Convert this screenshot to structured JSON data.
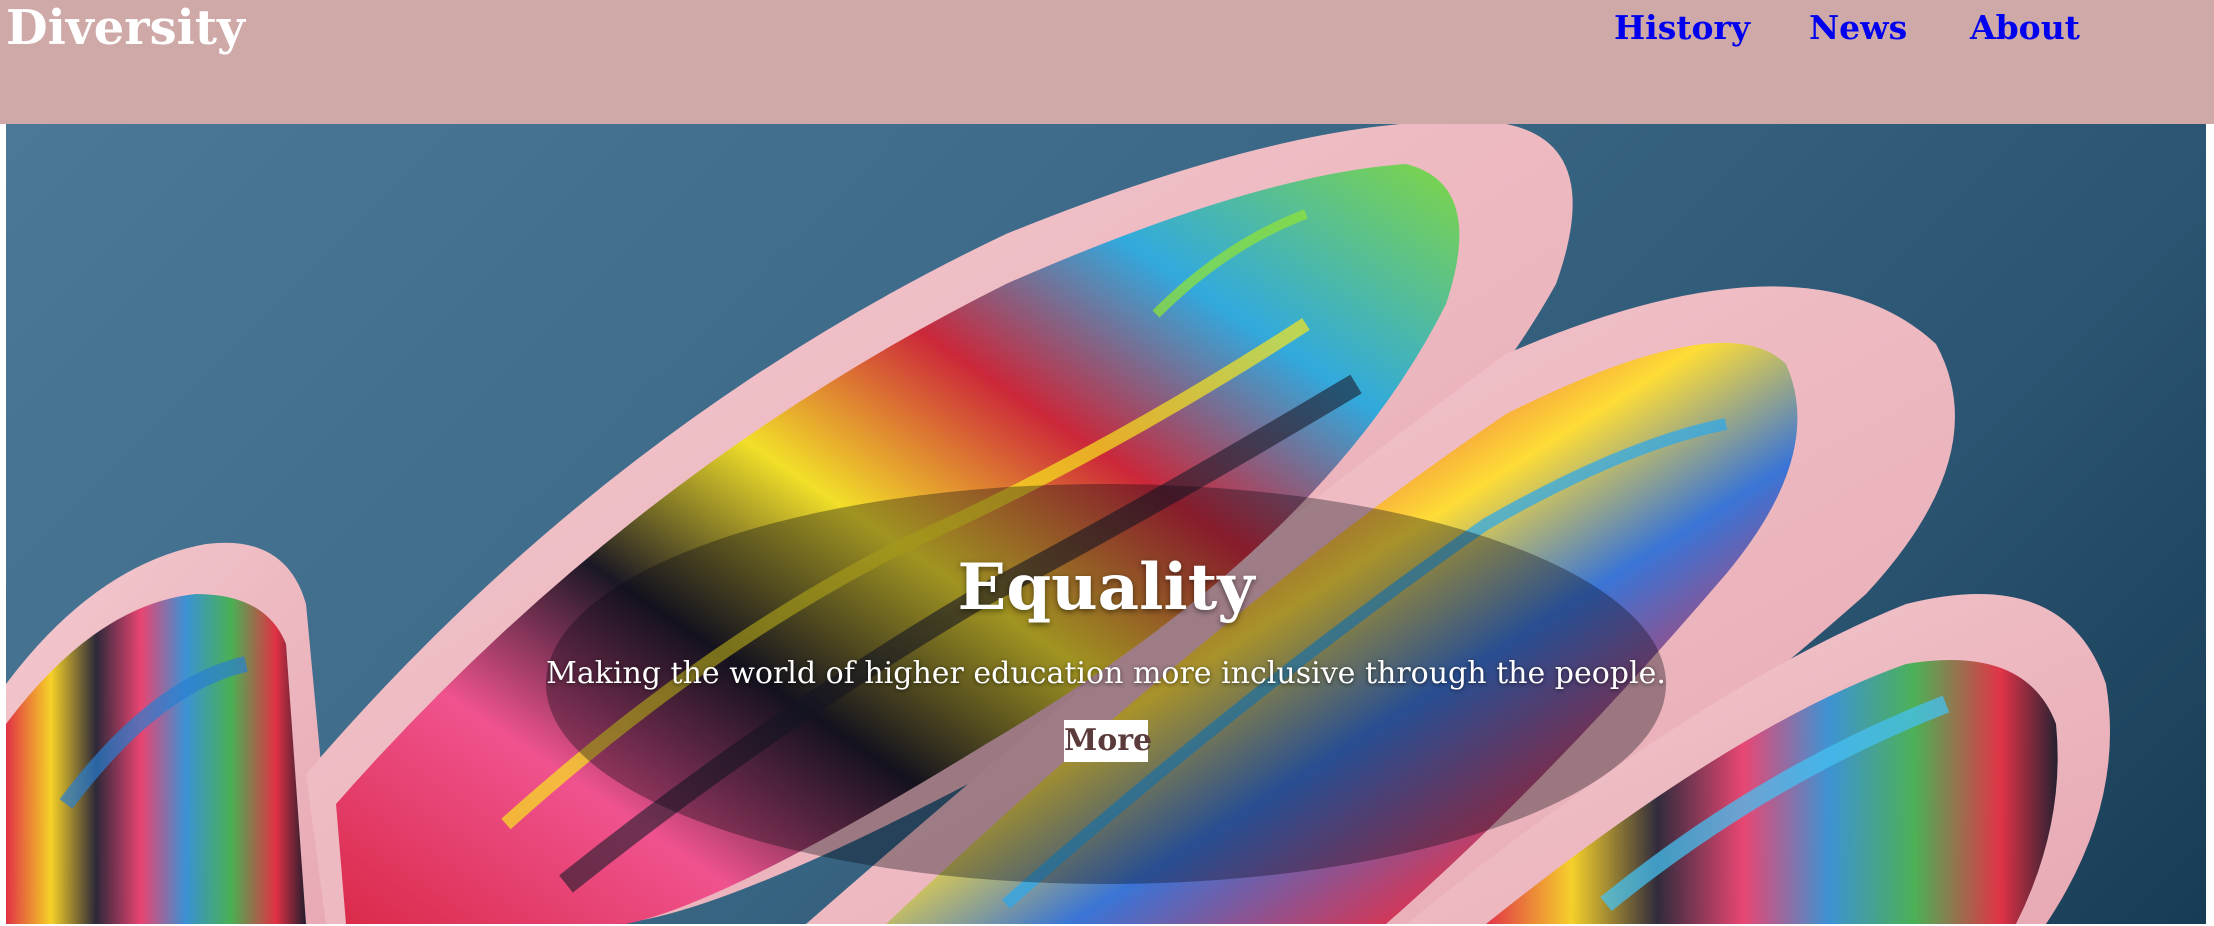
{
  "header": {
    "brand": "Diversity",
    "nav": [
      {
        "label": "History"
      },
      {
        "label": "News"
      },
      {
        "label": "About"
      }
    ]
  },
  "hero": {
    "title": "Equality",
    "subtitle": "Making the world of higher education more inclusive through the people.",
    "button_label": "More",
    "image_description_icon": "painted-hand-image"
  },
  "colors": {
    "header_background": "#cfa8a8",
    "brand_text": "#ffffff",
    "nav_link": "#0000ee",
    "hero_background": "#3c6a88",
    "button_text": "#5a3a3a"
  }
}
